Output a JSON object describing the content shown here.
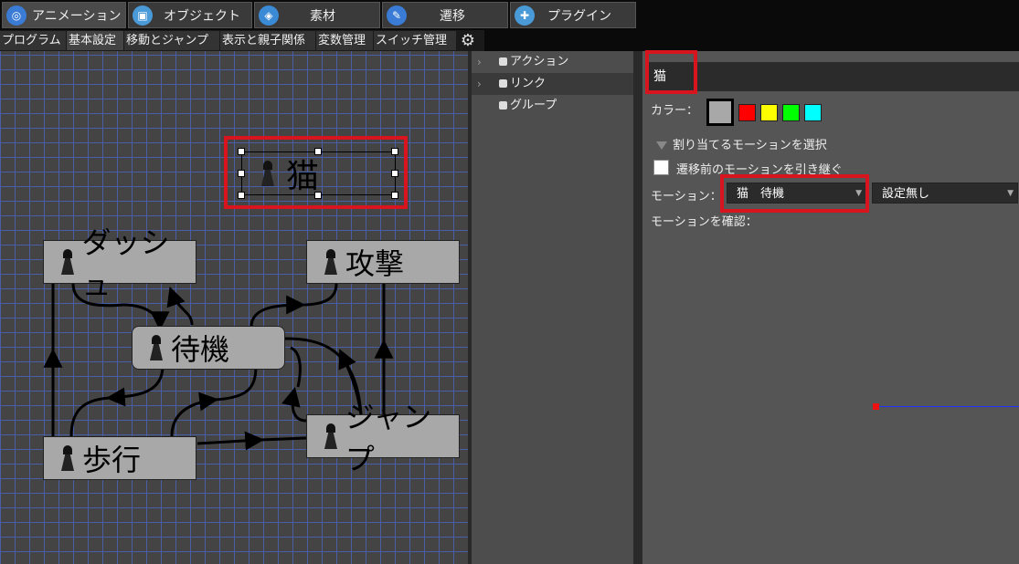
{
  "top_tabs": [
    {
      "label": "アニメーション",
      "icon": "animation-icon",
      "color": "#3a7bd5"
    },
    {
      "label": "オブジェクト",
      "icon": "object-icon",
      "color": "#4a9ad8"
    },
    {
      "label": "素材",
      "icon": "material-icon",
      "color": "#3a8ad5"
    },
    {
      "label": "遷移",
      "icon": "transition-icon",
      "color": "#3a7bd5"
    },
    {
      "label": "プラグイン",
      "icon": "plugin-icon",
      "color": "#4a9ad8"
    }
  ],
  "sub_tabs": [
    "プログラム",
    "基本設定",
    "移動とジャンプ",
    "表示と親子関係",
    "変数管理",
    "スイッチ管理"
  ],
  "canvas": {
    "selected_node": "猫",
    "nodes": {
      "dash": "ダッシュ",
      "attack": "攻撃",
      "idle": "待機",
      "walk": "歩行",
      "jump": "ジャンプ"
    }
  },
  "tree": {
    "items": [
      "アクション",
      "リンク",
      "グループ"
    ]
  },
  "props": {
    "name": "猫",
    "color_label": "カラー：",
    "colors": [
      "#a8a8a8",
      "#ff0000",
      "#ffff00",
      "#00ff00",
      "#00ffff"
    ],
    "section_title": "割り当てるモーションを選択",
    "inherit_label": "遷移前のモーションを引き継ぐ",
    "motion_label": "モーション：",
    "motion_value": "猫　待機",
    "setting_value": "設定無し",
    "confirm_label": "モーションを確認："
  }
}
